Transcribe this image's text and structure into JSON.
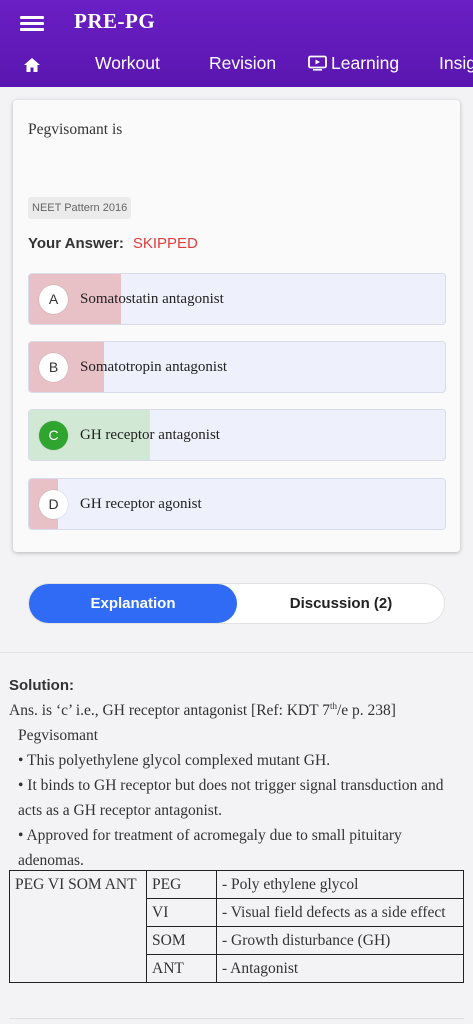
{
  "app": {
    "title": "PRE-PG"
  },
  "tabs": [
    {
      "label": "Workout"
    },
    {
      "label": "Revision"
    },
    {
      "label": "Learning"
    },
    {
      "label": "Insig"
    }
  ],
  "question": {
    "text": "Pegvisomant is",
    "tag": "NEET Pattern 2016",
    "your_answer_label": "Your Answer:",
    "your_answer_value": "SKIPPED",
    "options": [
      {
        "letter": "A",
        "text": "Somatostatin antagonist",
        "fill_fraction": 0.22,
        "fill_color": "#e8c1c7",
        "correct": false
      },
      {
        "letter": "B",
        "text": "Somatotropin antagonist",
        "fill_fraction": 0.18,
        "fill_color": "#e8c1c7",
        "correct": false
      },
      {
        "letter": "C",
        "text": "GH receptor antagonist",
        "fill_fraction": 0.29,
        "fill_color": "#d1e8d4",
        "correct": true
      },
      {
        "letter": "D",
        "text": "GH receptor agonist",
        "fill_fraction": 0.07,
        "fill_color": "#e8c1c7",
        "correct": false
      }
    ]
  },
  "toggle": {
    "explanation": "Explanation",
    "discussion": "Discussion (2)"
  },
  "solution": {
    "heading": "Solution:",
    "answer_line_a": "Ans. is ‘c’ i.e., GH receptor antagonist [Ref: KDT 7",
    "answer_sup": "th",
    "answer_line_b": "/e p. 238]",
    "subject": "Pegvisomant",
    "bullets": [
      "• This polyethylene glycol complexed mutant GH.",
      "• It binds to GH receptor but does not trigger signal transduction and acts as a GH receptor antagonist.",
      "• Approved for treatment of acromegaly due to small pituitary adenomas."
    ],
    "table": {
      "left": "PEG VI SOM ANT",
      "rows": [
        {
          "abbr": "PEG",
          "meaning": "- Poly ethylene glycol"
        },
        {
          "abbr": "VI",
          "meaning": "- Visual field defects as a side effect"
        },
        {
          "abbr": "SOM",
          "meaning": "- Growth disturbance (GH)"
        },
        {
          "abbr": "ANT",
          "meaning": "- Antagonist"
        }
      ]
    }
  },
  "colors": {
    "appbar": "#6a1fc4",
    "accent": "#2f6bf5",
    "skipped": "#e03c3c",
    "correct": "#2fa52f"
  }
}
